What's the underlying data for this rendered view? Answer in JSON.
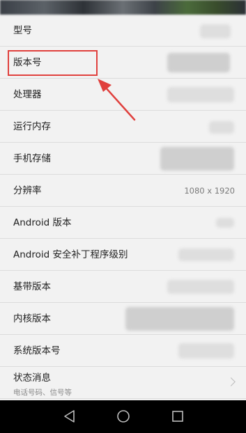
{
  "settings": {
    "rows": [
      {
        "label": "型号",
        "value": ""
      },
      {
        "label": "版本号",
        "value": ""
      },
      {
        "label": "处理器",
        "value": ""
      },
      {
        "label": "运行内存",
        "value": ""
      },
      {
        "label": "手机存储",
        "value": ""
      },
      {
        "label": "分辨率",
        "value": "1080 x 1920"
      },
      {
        "label": "Android 版本",
        "value": ""
      },
      {
        "label": "Android 安全补丁程序级别",
        "value": ""
      },
      {
        "label": "基带版本",
        "value": ""
      },
      {
        "label": "内核版本",
        "value": ""
      },
      {
        "label": "系统版本号",
        "value": ""
      }
    ],
    "status": {
      "label": "状态消息",
      "sub": "电话号码、信号等"
    }
  },
  "annotation": {
    "color": "#e0403d",
    "target": "版本号"
  },
  "navbar": {
    "icons": [
      "back-icon",
      "home-icon",
      "recents-icon"
    ]
  }
}
